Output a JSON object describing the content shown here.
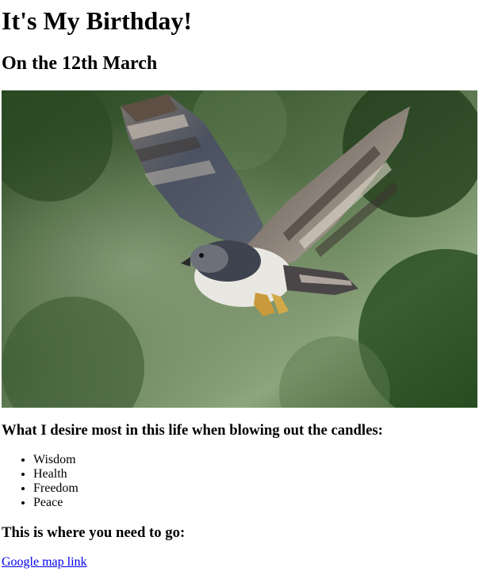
{
  "header": {
    "title": "It's My Birthday!",
    "subtitle": "On the 12th March"
  },
  "photo": {
    "subject": "harpy eagle in flight over green forest background",
    "colors": {
      "background_dark": "#1f3b1c",
      "background_mid": "#4d7040",
      "background_light": "#9bb48a",
      "wing_gray": "#5d6370",
      "wing_bar_light": "#d7d0c3",
      "wing_bar_dark": "#3d3330",
      "chest_white": "#f1f0ec",
      "talon_yellow": "#c89a3b"
    }
  },
  "desires": {
    "heading": "What I desire most in this life when blowing out the candles:",
    "items": [
      "Wisdom",
      "Health",
      "Freedom",
      "Peace"
    ]
  },
  "directions": {
    "heading": "This is where you need to go:",
    "link_label": "Google map link"
  }
}
